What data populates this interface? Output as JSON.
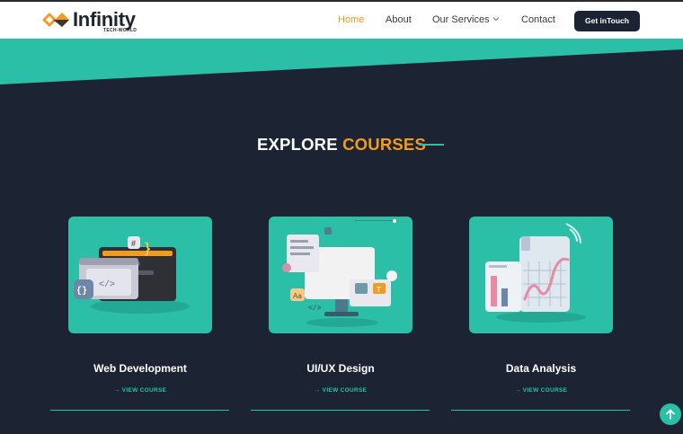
{
  "brand": {
    "name": "Infinity",
    "tagline": "TECH-WORLD",
    "color_orange": "#f29b1d",
    "color_dark": "#1e2330"
  },
  "nav": {
    "items": [
      {
        "label": "Home",
        "active": true
      },
      {
        "label": "About",
        "active": false
      },
      {
        "label": "Our Services",
        "active": false,
        "icon": "chevron-down-icon"
      },
      {
        "label": "Contact",
        "active": false
      }
    ],
    "cta_label": "Get inTouch"
  },
  "section": {
    "heading_white": "EXPLORE",
    "heading_orange": "COURSES"
  },
  "courses": [
    {
      "title": "Web Development",
      "link_label": "→ VIEW COURSE",
      "icon": "code-window-illustration"
    },
    {
      "title": "UI/UX Design",
      "link_label": "→ VIEW COURSE",
      "icon": "design-monitor-illustration"
    },
    {
      "title": "Data Analysis",
      "link_label": "→ VIEW COURSE",
      "icon": "chart-dashboard-illustration"
    }
  ],
  "colors": {
    "accent_teal": "#2bbfa8",
    "background": "#1c2434",
    "accent_orange": "#f29b1d"
  },
  "scroll_top": {
    "icon": "arrow-up-icon"
  }
}
